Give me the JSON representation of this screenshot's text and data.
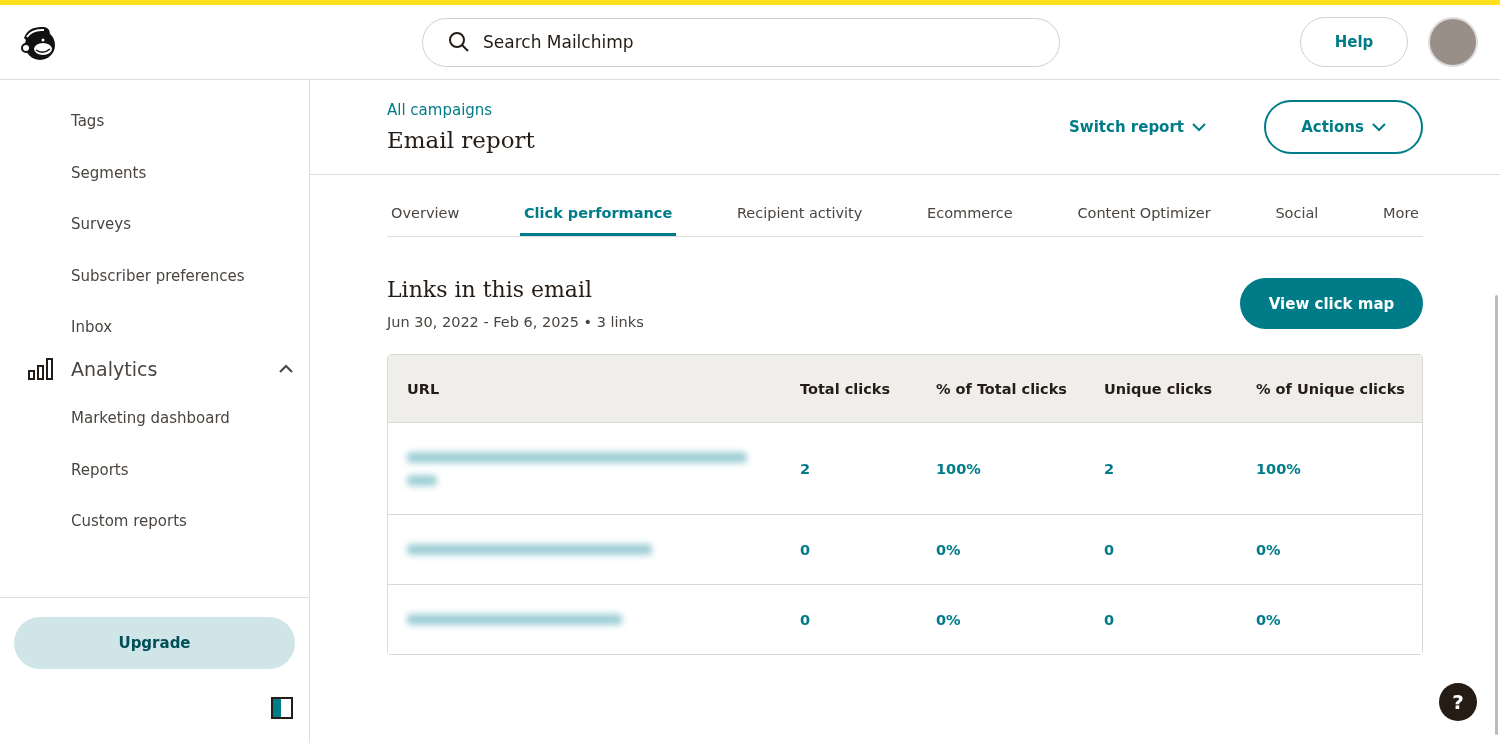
{
  "search": {
    "placeholder": "Search Mailchimp"
  },
  "header": {
    "help": "Help"
  },
  "sidebar": {
    "items": [
      {
        "kind": "link",
        "label": "Tags"
      },
      {
        "kind": "link",
        "label": "Segments"
      },
      {
        "kind": "link",
        "label": "Surveys"
      },
      {
        "kind": "link",
        "label": "Subscriber preferences"
      },
      {
        "kind": "link",
        "label": "Inbox"
      },
      {
        "kind": "section",
        "label": "Analytics",
        "expanded": true
      },
      {
        "kind": "link",
        "label": "Marketing dashboard"
      },
      {
        "kind": "link",
        "label": "Reports"
      },
      {
        "kind": "link",
        "label": "Custom reports"
      }
    ],
    "upgrade": "Upgrade"
  },
  "page": {
    "breadcrumb": "All campaigns",
    "title": "Email report",
    "switch_report": "Switch report",
    "actions": "Actions"
  },
  "tabs": [
    {
      "label": "Overview",
      "selected": false
    },
    {
      "label": "Click performance",
      "selected": true
    },
    {
      "label": "Recipient activity",
      "selected": false
    },
    {
      "label": "Ecommerce",
      "selected": false
    },
    {
      "label": "Content Optimizer",
      "selected": false
    },
    {
      "label": "Social",
      "selected": false
    },
    {
      "label": "More",
      "selected": false
    }
  ],
  "links_section": {
    "title": "Links in this email",
    "subtitle": "Jun 30, 2022 - Feb 6, 2025 • 3 links",
    "button": "View click map"
  },
  "table": {
    "columns": [
      "URL",
      "Total clicks",
      "% of Total clicks",
      "Unique clicks",
      "% of Unique clicks"
    ],
    "rows": [
      {
        "total": "2",
        "total_pct": "100%",
        "unique": "2",
        "unique_pct": "100%"
      },
      {
        "total": "0",
        "total_pct": "0%",
        "unique": "0",
        "unique_pct": "0%"
      },
      {
        "total": "0",
        "total_pct": "0%",
        "unique": "0",
        "unique_pct": "0%"
      }
    ]
  },
  "help_button": "?"
}
